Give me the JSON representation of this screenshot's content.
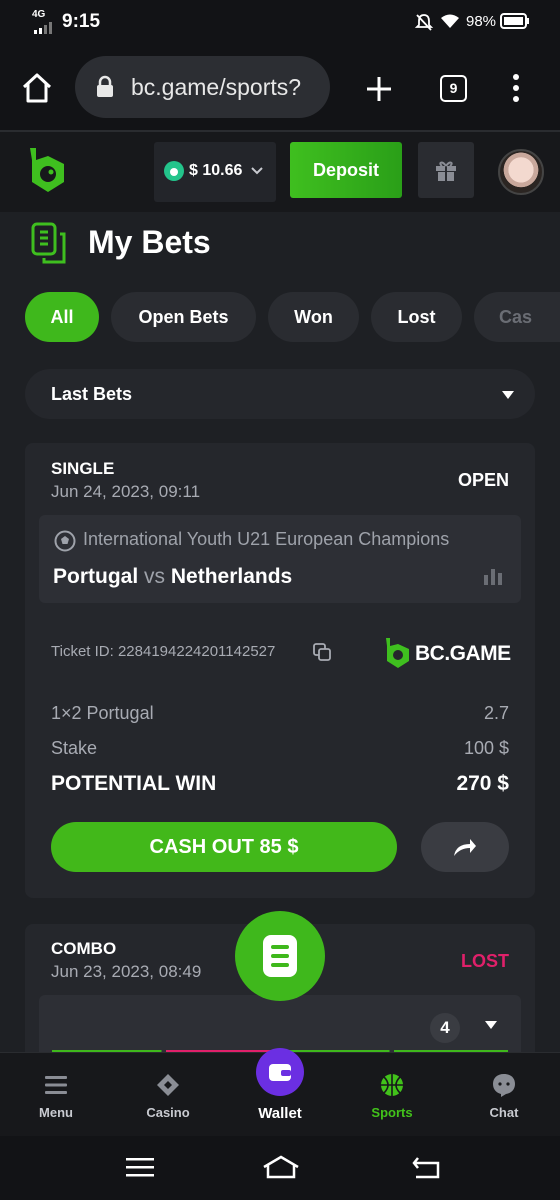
{
  "status_bar": {
    "time": "9:15",
    "network": "4G",
    "battery": "98%"
  },
  "browser": {
    "url": "bc.game/sports?",
    "tab_count": "9"
  },
  "header": {
    "balance": "$ 10.66",
    "deposit_label": "Deposit"
  },
  "page": {
    "title": "My Bets"
  },
  "filters": {
    "all": "All",
    "open": "Open Bets",
    "won": "Won",
    "lost": "Lost",
    "cashout": "Cas"
  },
  "sort": {
    "selected": "Last Bets"
  },
  "bets": [
    {
      "type": "SINGLE",
      "date": "Jun 24, 2023, 09:11",
      "status": "OPEN",
      "league": "International Youth U21 European Champions",
      "home": "Portugal",
      "vs": "vs",
      "away": "Netherlands",
      "ticket": "Ticket ID: 2284194224201142527",
      "brand": "BC.GAME",
      "selection": "1×2 Portugal",
      "odds": "2.7",
      "stake_label": "Stake",
      "stake": "100 $",
      "potential_label": "POTENTIAL WIN",
      "potential": "270 $",
      "cashout": "CASH OUT 85 $"
    },
    {
      "type": "COMBO",
      "date": "Jun 23, 2023, 08:49",
      "status": "LOST",
      "legs": "4"
    }
  ],
  "bottom_nav": {
    "menu": "Menu",
    "casino": "Casino",
    "wallet": "Wallet",
    "sports": "Sports",
    "chat": "Chat"
  },
  "colors": {
    "accent": "#3fb81c",
    "lost": "#e0206a",
    "wallet": "#6b2fe2"
  }
}
